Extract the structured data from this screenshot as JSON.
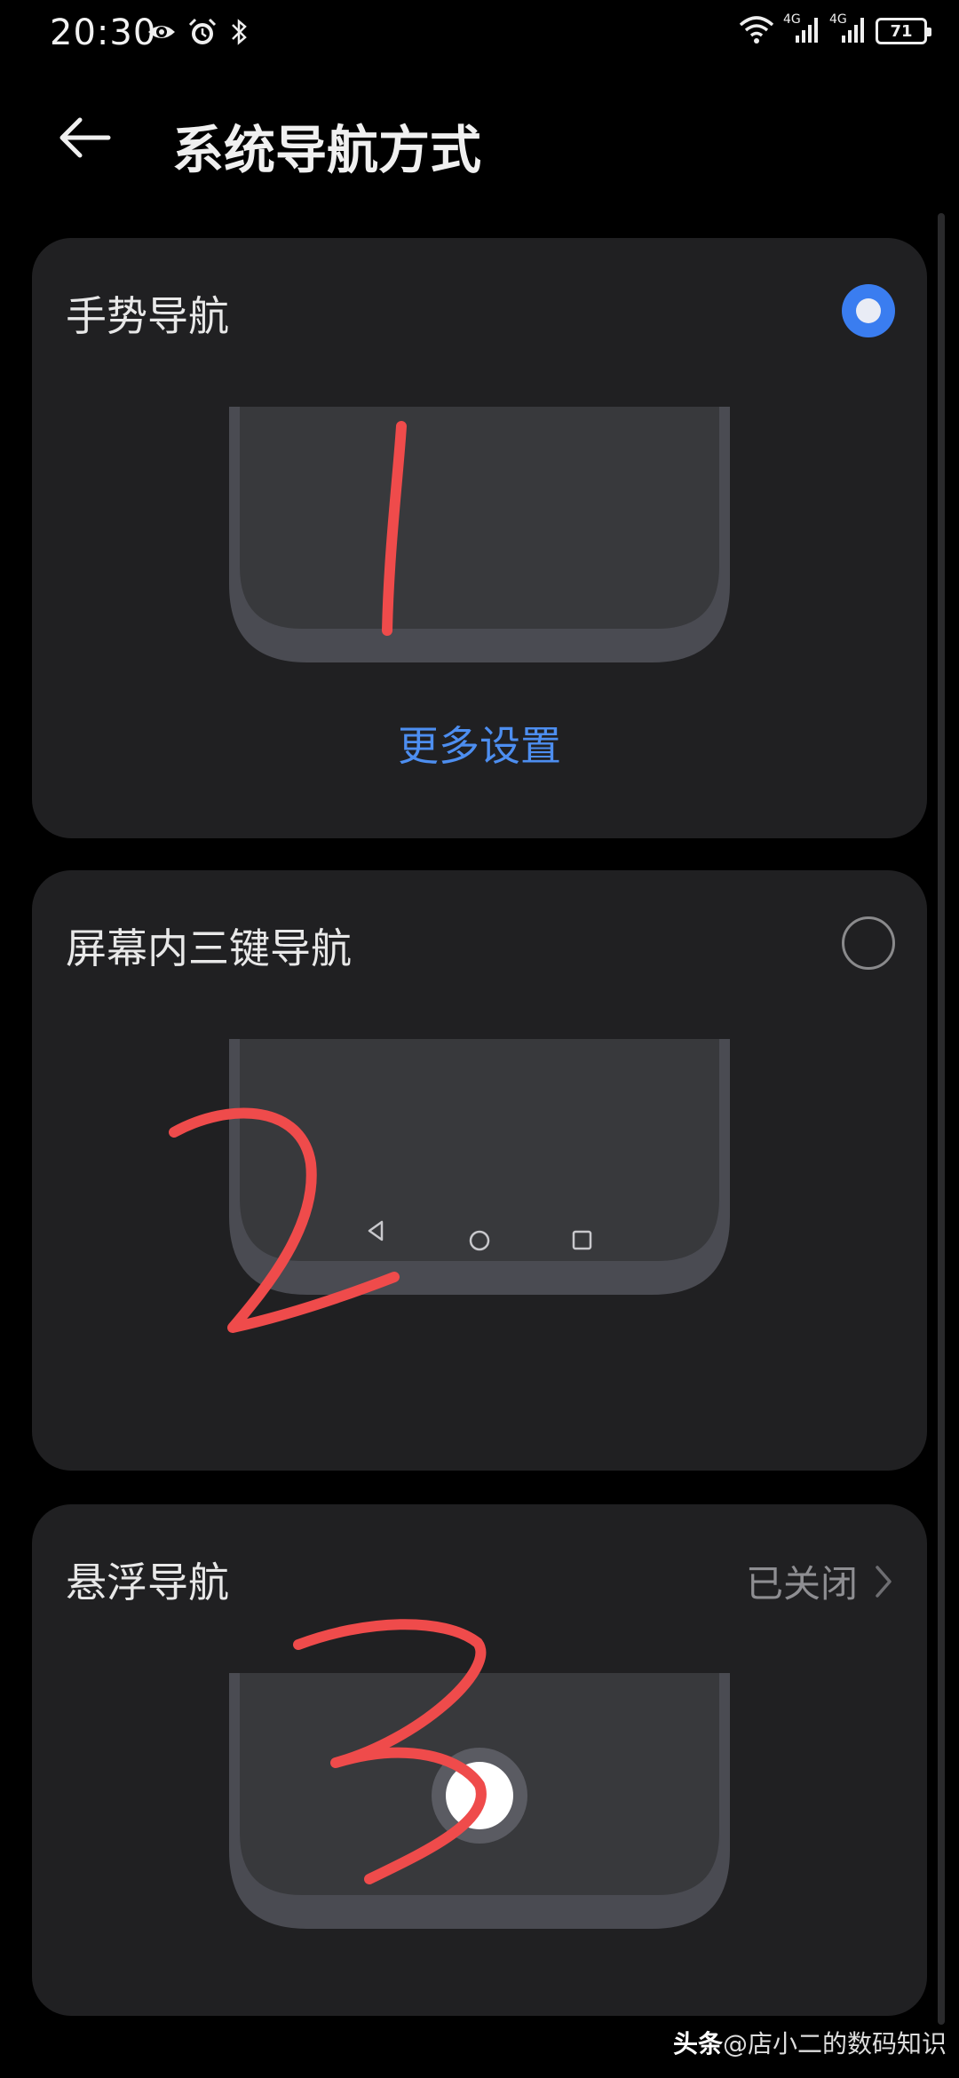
{
  "status_bar": {
    "time": "20:30",
    "network_1": "4G",
    "network_2": "4G",
    "battery": "71",
    "icons": [
      "eye-icon",
      "alarm-icon",
      "bluetooth-icon",
      "wifi-icon",
      "signal-icon",
      "signal-icon",
      "battery-icon"
    ]
  },
  "header": {
    "title": "系统导航方式"
  },
  "options": [
    {
      "title": "手势导航",
      "selected": true,
      "action_label": "更多设置",
      "scribble": "1"
    },
    {
      "title": "屏幕内三键导航",
      "selected": false,
      "nav_keys": [
        "back-triangle-icon",
        "home-circle-icon",
        "recents-square-icon"
      ],
      "scribble": "2"
    },
    {
      "title": "悬浮导航",
      "status": "已关闭",
      "scribble": "3"
    }
  ],
  "colors": {
    "accent": "#3a7df0",
    "link": "#4d8ef0",
    "card": "#202022",
    "scribble": "#ef4b4b"
  },
  "watermark": {
    "brand": "头条",
    "handle": "@店小二的数码知识"
  }
}
